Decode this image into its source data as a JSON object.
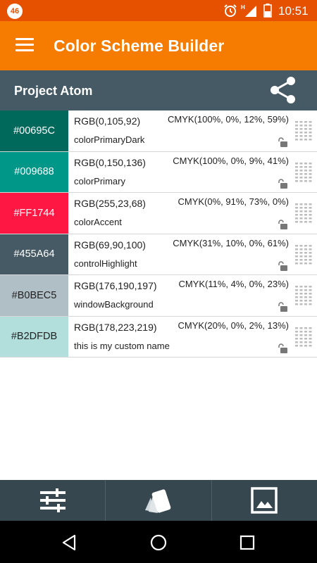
{
  "status_bar": {
    "notification_badge": "46",
    "network_label": "H",
    "time": "10:51",
    "background": "#E65100",
    "icons": [
      "alarm-icon",
      "signal-icon",
      "battery-icon"
    ]
  },
  "app_bar": {
    "title": "Color Scheme Builder",
    "background": "#F57C00",
    "menu_icon": "menu-icon"
  },
  "project": {
    "name": "Project Atom",
    "background": "#455A64",
    "share_icon": "share-icon"
  },
  "colors": [
    {
      "hex": "#00695C",
      "rgb": "RGB(0,105,92)",
      "cmyk": "CMYK(100%, 0%, 12%, 59%)",
      "name": "colorPrimaryDark",
      "text_color": "#ffffff"
    },
    {
      "hex": "#009688",
      "rgb": "RGB(0,150,136)",
      "cmyk": "CMYK(100%, 0%, 9%, 41%)",
      "name": "colorPrimary",
      "text_color": "#ffffff"
    },
    {
      "hex": "#FF1744",
      "rgb": "RGB(255,23,68)",
      "cmyk": "CMYK(0%, 91%, 73%, 0%)",
      "name": "colorAccent",
      "text_color": "#ffffff"
    },
    {
      "hex": "#455A64",
      "rgb": "RGB(69,90,100)",
      "cmyk": "CMYK(31%, 10%, 0%, 61%)",
      "name": "controlHighlight",
      "text_color": "#ffffff"
    },
    {
      "hex": "#B0BEC5",
      "rgb": "RGB(176,190,197)",
      "cmyk": "CMYK(11%, 4%, 0%, 23%)",
      "name": "windowBackground",
      "text_color": "#222222"
    },
    {
      "hex": "#B2DFDB",
      "rgb": "RGB(178,223,219)",
      "cmyk": "CMYK(20%, 0%, 2%, 13%)",
      "name": "this is my custom name",
      "text_color": "#222222"
    }
  ],
  "bottom_bar": {
    "background": "#37474F",
    "buttons": [
      "sliders-icon",
      "swatch-cards-icon",
      "image-icon"
    ]
  },
  "nav_bar": {
    "buttons": [
      "back-icon",
      "home-icon",
      "recents-icon"
    ]
  }
}
